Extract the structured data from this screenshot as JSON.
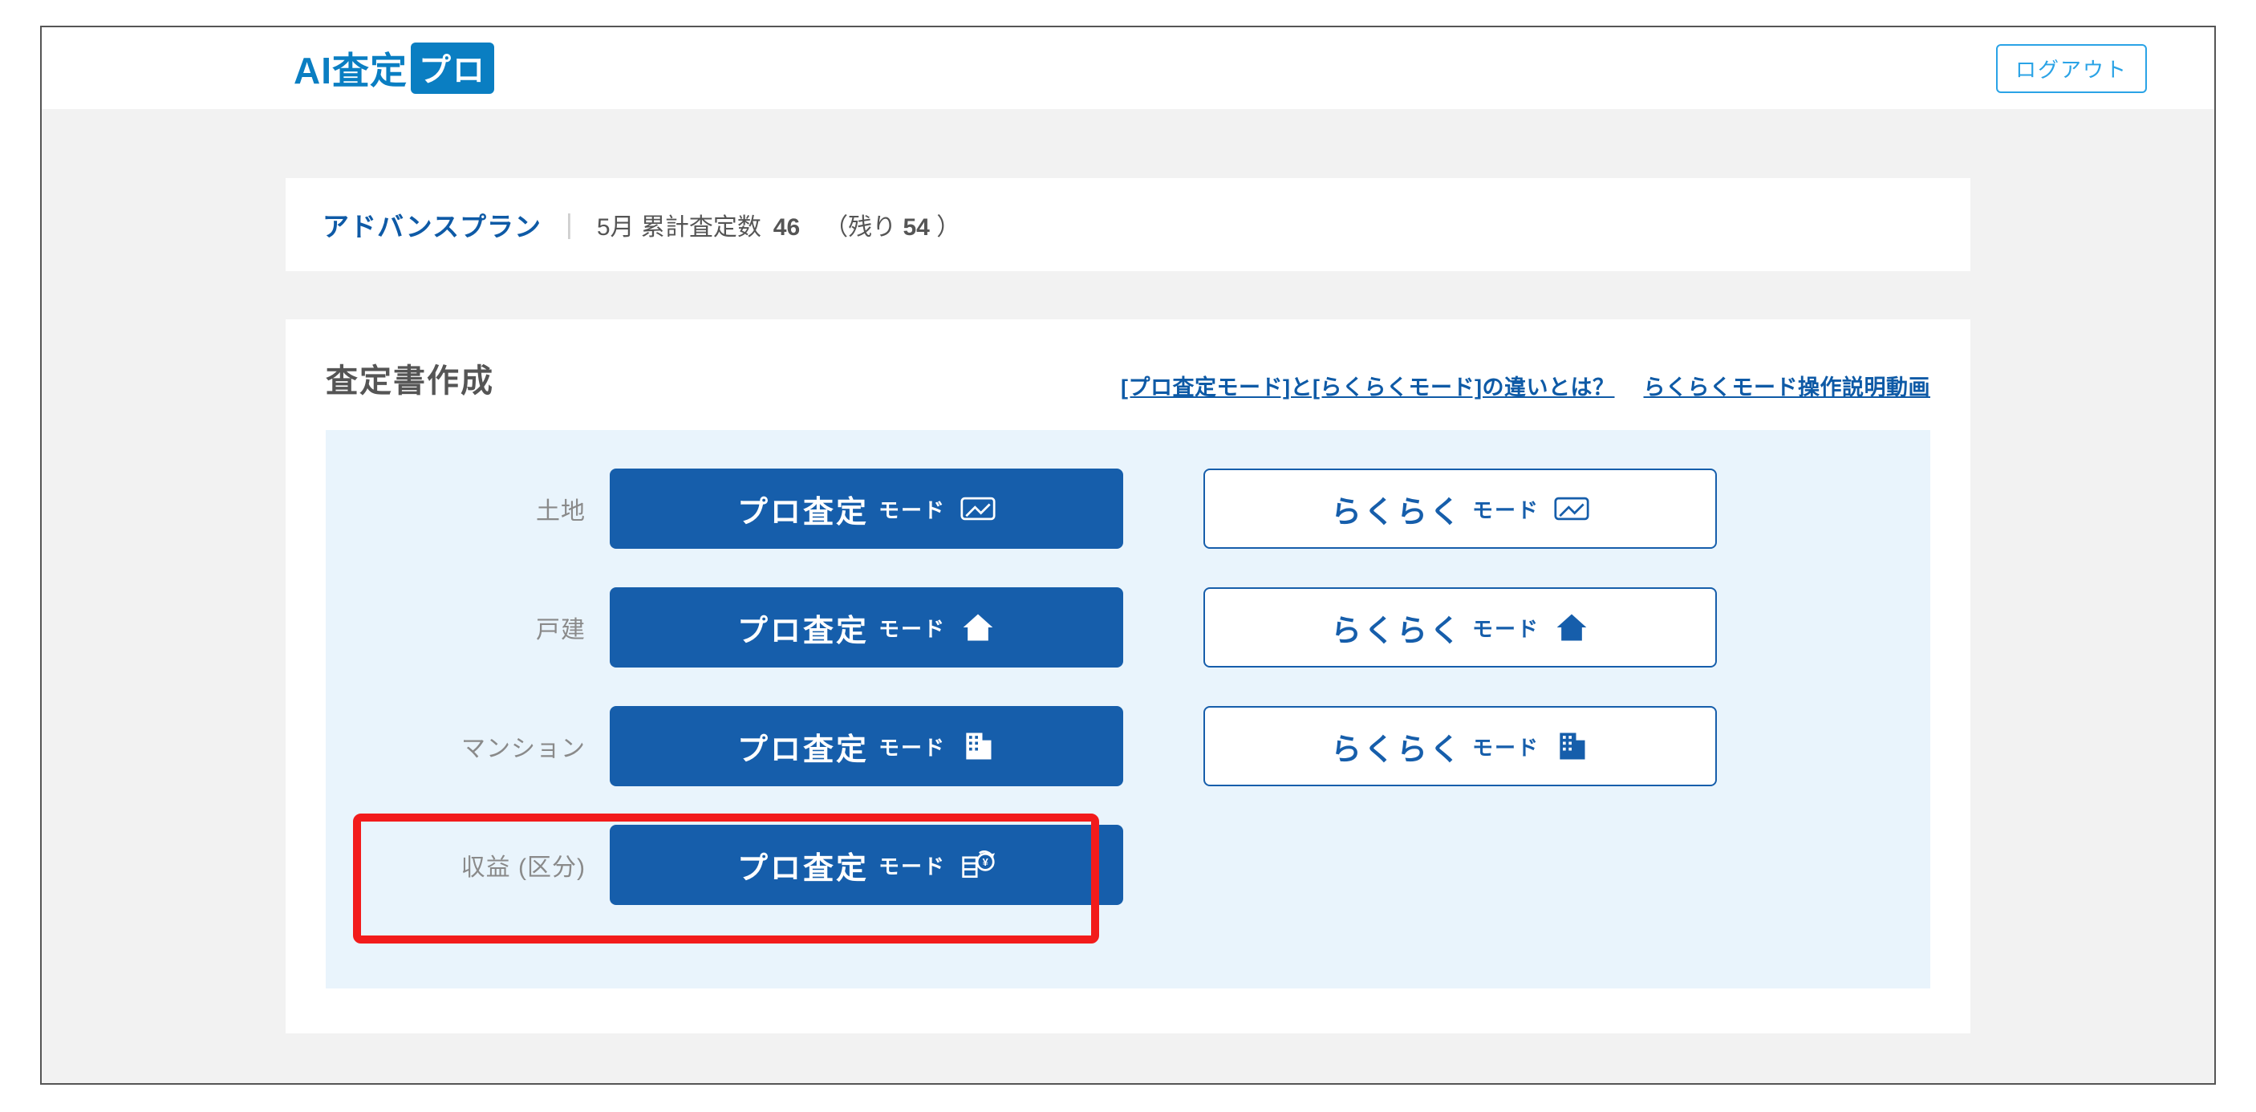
{
  "header": {
    "logo_text": "AI査定",
    "logo_badge": "プロ",
    "logout_label": "ログアウト"
  },
  "plan": {
    "name": "アドバンスプラン",
    "stat_label": "5月 累計査定数",
    "stat_value": "46",
    "remain_prefix": "（残り",
    "remain_value": "54",
    "remain_suffix": "）"
  },
  "create": {
    "title": "査定書作成",
    "link_diff": "[プロ査定モード]と[らくらくモード]の違いとは？",
    "link_video": "らくらくモード操作説明動画",
    "row_labels": {
      "land": "土地",
      "house": "戸建",
      "mansion": "マンション",
      "income": "収益 (区分)"
    },
    "button_primary_big": "プロ査定",
    "button_primary_small": "モード",
    "button_outline_big": "らくらく",
    "button_outline_small": "モード"
  },
  "colors": {
    "brand": "#165eab",
    "accent": "#0a7ec2",
    "highlight": "#f21b1b"
  }
}
